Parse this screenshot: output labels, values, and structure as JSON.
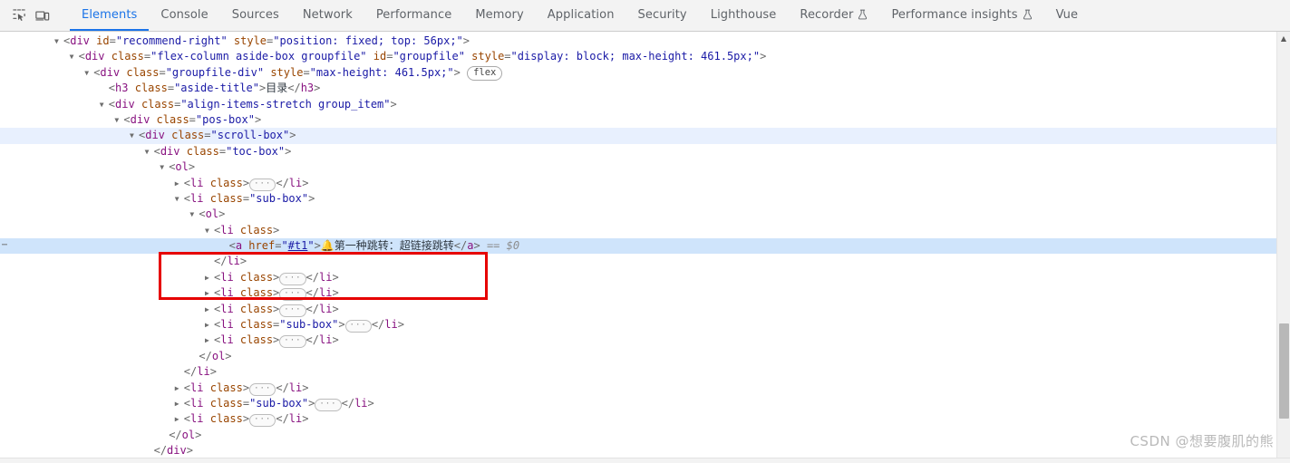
{
  "toolbar": {
    "icons": [
      {
        "name": "inspect-element-icon",
        "label": "Inspect element"
      },
      {
        "name": "device-toolbar-icon",
        "label": "Toggle device toolbar"
      }
    ],
    "tabs": [
      {
        "label": "Elements",
        "active": true,
        "flask": false
      },
      {
        "label": "Console",
        "active": false,
        "flask": false
      },
      {
        "label": "Sources",
        "active": false,
        "flask": false
      },
      {
        "label": "Network",
        "active": false,
        "flask": false
      },
      {
        "label": "Performance",
        "active": false,
        "flask": false
      },
      {
        "label": "Memory",
        "active": false,
        "flask": false
      },
      {
        "label": "Application",
        "active": false,
        "flask": false
      },
      {
        "label": "Security",
        "active": false,
        "flask": false
      },
      {
        "label": "Lighthouse",
        "active": false,
        "flask": false
      },
      {
        "label": "Recorder",
        "active": false,
        "flask": true
      },
      {
        "label": "Performance insights",
        "active": false,
        "flask": true
      },
      {
        "label": "Vue",
        "active": false,
        "flask": false
      }
    ]
  },
  "dom_tree": {
    "gutter_more_label": "⋯",
    "ellipsis_label": "···",
    "flex_badge": "flex",
    "rows": [
      {
        "id": "r0",
        "indent": 0,
        "tri": "open",
        "html": "<span class='t-punc'>&lt;</span><span class='t-tag'>div</span> <span class='t-attr'>id</span><span class='t-punc'>=</span><span class='t-val'>\"recommend-right\"</span> <span class='t-attr'>style</span><span class='t-punc'>=</span><span class='t-val'>\"position: fixed; top: 56px;\"</span><span class='t-punc'>&gt;</span>"
      },
      {
        "id": "r1",
        "indent": 1,
        "tri": "open",
        "html": "<span class='t-punc'>&lt;</span><span class='t-tag'>div</span> <span class='t-attr'>class</span><span class='t-punc'>=</span><span class='t-val'>\"flex-column aside-box groupfile\"</span> <span class='t-attr'>id</span><span class='t-punc'>=</span><span class='t-val'>\"groupfile\"</span> <span class='t-attr'>style</span><span class='t-punc'>=</span><span class='t-val'>\"display: block; max-height: 461.5px;\"</span><span class='t-punc'>&gt;</span>"
      },
      {
        "id": "r2",
        "indent": 2,
        "tri": "open",
        "html": "<span class='t-punc'>&lt;</span><span class='t-tag'>div</span> <span class='t-attr'>class</span><span class='t-punc'>=</span><span class='t-val'>\"groupfile-div\"</span> <span class='t-attr'>style</span><span class='t-punc'>=</span><span class='t-val'>\"max-height: 461.5px;\"</span><span class='t-punc'>&gt;</span> <span class='badge-flex'>flex</span>"
      },
      {
        "id": "r3",
        "indent": 3,
        "tri": "none",
        "html": "<span class='t-punc'>&lt;</span><span class='t-tag'>h3</span> <span class='t-attr'>class</span><span class='t-punc'>=</span><span class='t-val'>\"aside-title\"</span><span class='t-punc'>&gt;</span><span class='t-text'>目录</span><span class='t-punc'>&lt;/</span><span class='t-tag'>h3</span><span class='t-punc'>&gt;</span>"
      },
      {
        "id": "r4",
        "indent": 3,
        "tri": "open",
        "html": "<span class='t-punc'>&lt;</span><span class='t-tag'>div</span> <span class='t-attr'>class</span><span class='t-punc'>=</span><span class='t-val'>\"align-items-stretch group_item\"</span><span class='t-punc'>&gt;</span>"
      },
      {
        "id": "r5",
        "indent": 4,
        "tri": "open",
        "html": "<span class='t-punc'>&lt;</span><span class='t-tag'>div</span> <span class='t-attr'>class</span><span class='t-punc'>=</span><span class='t-val'>\"pos-box\"</span><span class='t-punc'>&gt;</span>"
      },
      {
        "id": "r6",
        "indent": 5,
        "tri": "open",
        "sel_light": true,
        "html": "<span class='t-punc'>&lt;</span><span class='t-tag'>div</span> <span class='t-attr'>class</span><span class='t-punc'>=</span><span class='t-val'>\"scroll-box\"</span><span class='t-punc'>&gt;</span>"
      },
      {
        "id": "r7",
        "indent": 6,
        "tri": "open",
        "html": "<span class='t-punc'>&lt;</span><span class='t-tag'>div</span> <span class='t-attr'>class</span><span class='t-punc'>=</span><span class='t-val'>\"toc-box\"</span><span class='t-punc'>&gt;</span>"
      },
      {
        "id": "r8",
        "indent": 7,
        "tri": "open",
        "html": "<span class='t-punc'>&lt;</span><span class='t-tag'>ol</span><span class='t-punc'>&gt;</span>"
      },
      {
        "id": "r9",
        "indent": 8,
        "tri": "closed",
        "html": "<span class='t-punc'>&lt;</span><span class='t-tag'>li</span> <span class='t-attr'>class</span><span class='t-punc'>&gt;</span><span class='ellipsis-node'>···</span><span class='t-punc'>&lt;/</span><span class='t-tag'>li</span><span class='t-punc'>&gt;</span>"
      },
      {
        "id": "r10",
        "indent": 8,
        "tri": "open",
        "html": "<span class='t-punc'>&lt;</span><span class='t-tag'>li</span> <span class='t-attr'>class</span><span class='t-punc'>=</span><span class='t-val'>\"sub-box\"</span><span class='t-punc'>&gt;</span>"
      },
      {
        "id": "r11",
        "indent": 9,
        "tri": "open",
        "html": "<span class='t-punc'>&lt;</span><span class='t-tag'>ol</span><span class='t-punc'>&gt;</span>"
      },
      {
        "id": "r12",
        "indent": 10,
        "tri": "open",
        "html": "<span class='t-punc'>&lt;</span><span class='t-tag'>li</span> <span class='t-attr'>class</span><span class='t-punc'>&gt;</span>"
      },
      {
        "id": "r13",
        "indent": 11,
        "tri": "none",
        "sel": true,
        "gutter": true,
        "html": "<span class='t-punc'>&lt;</span><span class='t-tag'>a</span> <span class='t-attr'>href</span><span class='t-punc'>=</span><span class='t-val'>\"</span><span class='t-link'>#t1</span><span class='t-val'>\"</span><span class='t-punc'>&gt;</span><span class='emoji-bell'>🔔</span><span class='t-text'>第一种跳转：超链接跳转</span><span class='t-punc'>&lt;/</span><span class='t-tag'>a</span><span class='t-punc'>&gt;</span> <span class='t-gray'>== $0</span>"
      },
      {
        "id": "r14",
        "indent": 10,
        "tri": "none",
        "html": "<span class='t-punc'>&lt;/</span><span class='t-tag'>li</span><span class='t-punc'>&gt;</span>"
      },
      {
        "id": "r15",
        "indent": 10,
        "tri": "closed",
        "html": "<span class='t-punc'>&lt;</span><span class='t-tag'>li</span> <span class='t-attr'>class</span><span class='t-punc'>&gt;</span><span class='ellipsis-node'>···</span><span class='t-punc'>&lt;/</span><span class='t-tag'>li</span><span class='t-punc'>&gt;</span>"
      },
      {
        "id": "r16",
        "indent": 10,
        "tri": "closed",
        "html": "<span class='t-punc'>&lt;</span><span class='t-tag'>li</span> <span class='t-attr'>class</span><span class='t-punc'>&gt;</span><span class='ellipsis-node'>···</span><span class='t-punc'>&lt;/</span><span class='t-tag'>li</span><span class='t-punc'>&gt;</span>"
      },
      {
        "id": "r17",
        "indent": 10,
        "tri": "closed",
        "html": "<span class='t-punc'>&lt;</span><span class='t-tag'>li</span> <span class='t-attr'>class</span><span class='t-punc'>&gt;</span><span class='ellipsis-node'>···</span><span class='t-punc'>&lt;/</span><span class='t-tag'>li</span><span class='t-punc'>&gt;</span>"
      },
      {
        "id": "r18",
        "indent": 10,
        "tri": "closed",
        "html": "<span class='t-punc'>&lt;</span><span class='t-tag'>li</span> <span class='t-attr'>class</span><span class='t-punc'>=</span><span class='t-val'>\"sub-box\"</span><span class='t-punc'>&gt;</span><span class='ellipsis-node'>···</span><span class='t-punc'>&lt;/</span><span class='t-tag'>li</span><span class='t-punc'>&gt;</span>"
      },
      {
        "id": "r19",
        "indent": 10,
        "tri": "closed",
        "html": "<span class='t-punc'>&lt;</span><span class='t-tag'>li</span> <span class='t-attr'>class</span><span class='t-punc'>&gt;</span><span class='ellipsis-node'>···</span><span class='t-punc'>&lt;/</span><span class='t-tag'>li</span><span class='t-punc'>&gt;</span>"
      },
      {
        "id": "r20",
        "indent": 9,
        "tri": "none",
        "html": "<span class='t-punc'>&lt;/</span><span class='t-tag'>ol</span><span class='t-punc'>&gt;</span>"
      },
      {
        "id": "r21",
        "indent": 8,
        "tri": "none",
        "html": "<span class='t-punc'>&lt;/</span><span class='t-tag'>li</span><span class='t-punc'>&gt;</span>"
      },
      {
        "id": "r22",
        "indent": 8,
        "tri": "closed",
        "html": "<span class='t-punc'>&lt;</span><span class='t-tag'>li</span> <span class='t-attr'>class</span><span class='t-punc'>&gt;</span><span class='ellipsis-node'>···</span><span class='t-punc'>&lt;/</span><span class='t-tag'>li</span><span class='t-punc'>&gt;</span>"
      },
      {
        "id": "r23",
        "indent": 8,
        "tri": "closed",
        "html": "<span class='t-punc'>&lt;</span><span class='t-tag'>li</span> <span class='t-attr'>class</span><span class='t-punc'>=</span><span class='t-val'>\"sub-box\"</span><span class='t-punc'>&gt;</span><span class='ellipsis-node'>···</span><span class='t-punc'>&lt;/</span><span class='t-tag'>li</span><span class='t-punc'>&gt;</span>"
      },
      {
        "id": "r24",
        "indent": 8,
        "tri": "closed",
        "html": "<span class='t-punc'>&lt;</span><span class='t-tag'>li</span> <span class='t-attr'>class</span><span class='t-punc'>&gt;</span><span class='ellipsis-node'>···</span><span class='t-punc'>&lt;/</span><span class='t-tag'>li</span><span class='t-punc'>&gt;</span>"
      },
      {
        "id": "r25",
        "indent": 7,
        "tri": "none",
        "html": "<span class='t-punc'>&lt;/</span><span class='t-tag'>ol</span><span class='t-punc'>&gt;</span>"
      },
      {
        "id": "r26",
        "indent": 6,
        "tri": "none",
        "html": "<span class='t-punc'>&lt;/</span><span class='t-tag'>div</span><span class='t-punc'>&gt;</span>"
      }
    ]
  },
  "selected_node": {
    "tag": "a",
    "href": "#t1",
    "emoji": "🔔",
    "text": "第一种跳转：超链接跳转",
    "console_ref": "== $0"
  },
  "annotation": {
    "color": "#e60000",
    "shape": "rectangle"
  },
  "scrollbar": {
    "up_arrow": "▲",
    "down_arrow": "▼"
  },
  "watermark": {
    "text": "CSDN @想要腹肌的熊"
  }
}
